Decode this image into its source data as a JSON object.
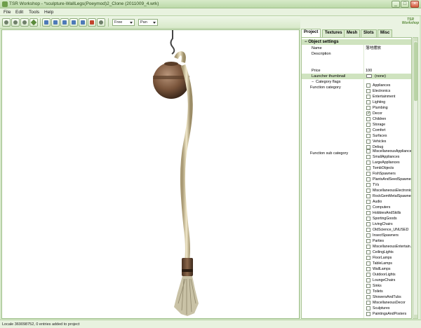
{
  "window": {
    "title": "TSR Workshop - *sculpture-WallLegs(Poeymod)2_Clone (2011009_4.wrk)",
    "minimize": "_",
    "maximize": "□",
    "close": "×"
  },
  "menu": [
    "File",
    "Edit",
    "Tools",
    "Help"
  ],
  "toolbar": {
    "camera_mode": "Free",
    "nav_mode": "Pan"
  },
  "tabs": [
    "Project",
    "Textures",
    "Mesh",
    "Slots",
    "Misc"
  ],
  "logo": "TSR Workshop",
  "properties": {
    "object_settings_label": "Object settings",
    "name_label": "Name",
    "name_value": "落地摆放",
    "description_label": "Description",
    "price_label": "Price",
    "price_value": "100",
    "launcher_thumbnail_label": "Launcher thumbnail",
    "launcher_thumbnail_value": "(none)",
    "category_flags_label": "Category flags",
    "function_category_label": "Function category",
    "function_sub_category_label": "Function sub category"
  },
  "function_categories": [
    {
      "label": "Appliances",
      "checked": false
    },
    {
      "label": "Electronics",
      "checked": false
    },
    {
      "label": "Entertainment",
      "checked": false
    },
    {
      "label": "Lighting",
      "checked": false
    },
    {
      "label": "Plumbing",
      "checked": false
    },
    {
      "label": "Decor",
      "checked": true
    },
    {
      "label": "Children",
      "checked": false
    },
    {
      "label": "Storage",
      "checked": false
    },
    {
      "label": "Comfort",
      "checked": false
    },
    {
      "label": "Surfaces",
      "checked": false
    },
    {
      "label": "Vehicles",
      "checked": false
    },
    {
      "label": "Debug",
      "checked": false
    }
  ],
  "function_sub_categories": [
    {
      "label": "MiscellaneousAppliances",
      "checked": false
    },
    {
      "label": "SmallAppliances",
      "checked": false
    },
    {
      "label": "LargeAppliances",
      "checked": false
    },
    {
      "label": "TombObjects",
      "checked": false
    },
    {
      "label": "FishSpawners",
      "checked": false
    },
    {
      "label": "PlantsAndSeedSpawners",
      "checked": false
    },
    {
      "label": "TVs",
      "checked": false
    },
    {
      "label": "MiscellaneousElectronics",
      "checked": false
    },
    {
      "label": "RockGemMetalSpawners",
      "checked": false
    },
    {
      "label": "Audio",
      "checked": false
    },
    {
      "label": "Computers",
      "checked": false
    },
    {
      "label": "HobbiesAndSkills",
      "checked": false
    },
    {
      "label": "SportingGoods",
      "checked": false
    },
    {
      "label": "LivingChairs",
      "checked": false
    },
    {
      "label": "OldScience_UNUSED",
      "checked": false
    },
    {
      "label": "InsectSpawners",
      "checked": false
    },
    {
      "label": "Parties",
      "checked": false
    },
    {
      "label": "MiscellaneousEntertain...",
      "checked": false
    },
    {
      "label": "CeilingLights",
      "checked": false
    },
    {
      "label": "FloorLamps",
      "checked": false
    },
    {
      "label": "TableLamps",
      "checked": false
    },
    {
      "label": "WallLamps",
      "checked": false
    },
    {
      "label": "OutdoorLights",
      "checked": false
    },
    {
      "label": "LoungeChairs",
      "checked": false
    },
    {
      "label": "Sinks",
      "checked": false
    },
    {
      "label": "Toilets",
      "checked": false
    },
    {
      "label": "ShowersAndTubs",
      "checked": false
    },
    {
      "label": "MiscellaneousDecor",
      "checked": false
    },
    {
      "label": "Sculptures",
      "checked": false
    },
    {
      "label": "PaintingsAndPosters",
      "checked": false
    }
  ],
  "status": "Locale 369098752, 0 entries added to project",
  "colors": {
    "chrome": "#d4e7c8",
    "panel": "#eaf3e2",
    "accent": "#5a8a3a"
  }
}
